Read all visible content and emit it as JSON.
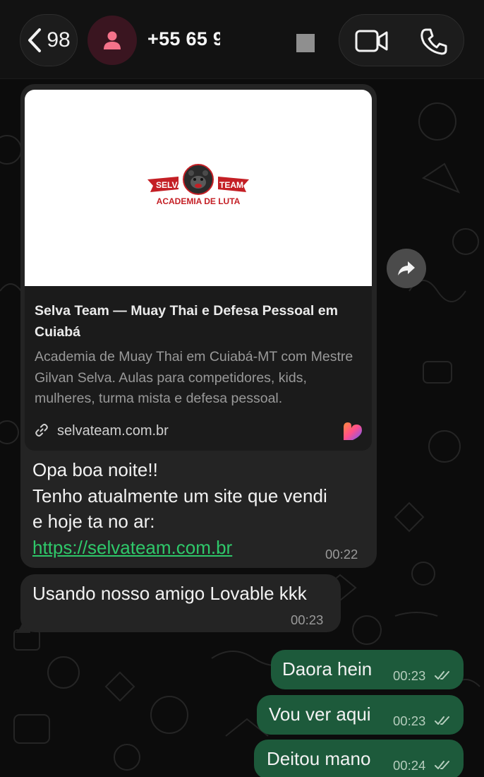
{
  "header": {
    "back_count": "98",
    "contact_name": "+55 65 9"
  },
  "messages": {
    "link_preview": {
      "title": "Selva Team — Muay Thai e Defesa Pessoal em Cuiabá",
      "description": "Academia de Muay Thai em Cuiabá-MT com Mestre Gilvan Selva. Aulas para competidores, kids, mulheres, turma mista e defesa pessoal.",
      "domain": "selvateam.com.br",
      "logo": {
        "left_text": "SELVA",
        "right_text": "TEAM",
        "tagline": "ACADEMIA DE LUTA"
      }
    },
    "first": {
      "line1": "Opa boa noite!!",
      "line2": "Tenho atualmente um site que vendi",
      "line3": "e hoje ta no ar:",
      "link": "https://selvateam.com.br",
      "time": "00:22"
    },
    "second": {
      "text": "Usando nosso amigo Lovable kkk",
      "time": "00:23"
    },
    "outgoing": [
      {
        "text": "Daora hein",
        "time": "00:23",
        "status": "read"
      },
      {
        "text": "Vou ver aqui",
        "time": "00:23",
        "status": "read"
      },
      {
        "text": "Deitou mano",
        "time": "00:24",
        "status": "read"
      }
    ]
  },
  "colors": {
    "incoming_bubble": "#242424",
    "outgoing_bubble": "#1d5a3b",
    "link": "#2fc86a",
    "header": "#121212"
  },
  "icons": [
    "chevron-left-icon",
    "person-icon",
    "video-camera-icon",
    "phone-icon",
    "forward-icon",
    "link-icon",
    "lovable-heart-icon",
    "double-check-icon"
  ]
}
